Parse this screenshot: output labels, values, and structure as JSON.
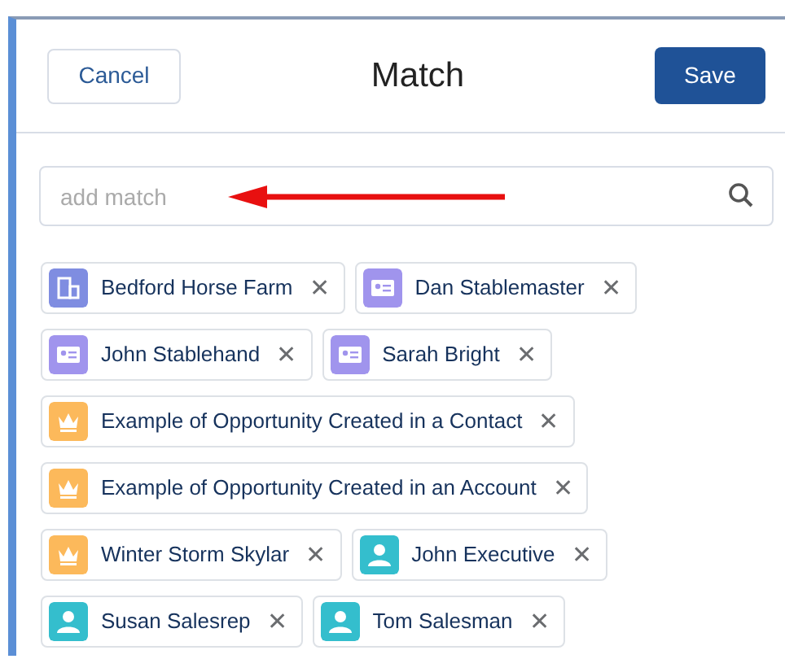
{
  "header": {
    "cancel": "Cancel",
    "title": "Match",
    "save": "Save"
  },
  "search": {
    "placeholder": "add match"
  },
  "annotation": {
    "kind": "arrow"
  },
  "tag_rows": [
    [
      {
        "kind": "account",
        "label": "Bedford Horse Farm",
        "remove": "✕"
      },
      {
        "kind": "contact",
        "label": "Dan Stablemaster",
        "remove": "✕"
      }
    ],
    [
      {
        "kind": "contact",
        "label": "John Stablehand",
        "remove": "✕"
      },
      {
        "kind": "contact",
        "label": "Sarah Bright",
        "remove": "✕"
      }
    ],
    [
      {
        "kind": "opportunity",
        "label": "Example of Opportunity Created in a Contact",
        "remove": "✕"
      }
    ],
    [
      {
        "kind": "opportunity",
        "label": "Example of Opportunity Created in an Account",
        "remove": "✕"
      }
    ],
    [
      {
        "kind": "opportunity",
        "label": "Winter Storm Skylar",
        "remove": "✕"
      },
      {
        "kind": "user",
        "label": "John Executive",
        "remove": "✕"
      }
    ],
    [
      {
        "kind": "user",
        "label": "Susan Salesrep",
        "remove": "✕"
      },
      {
        "kind": "user",
        "label": "Tom Salesman",
        "remove": "✕"
      }
    ]
  ]
}
